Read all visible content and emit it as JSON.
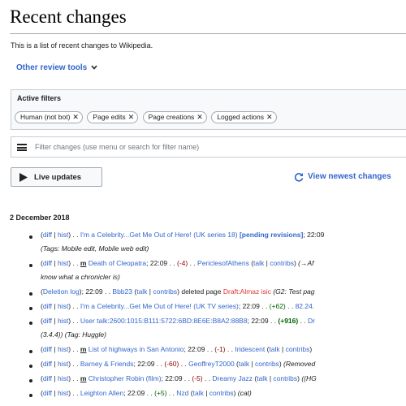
{
  "page": {
    "title": "Recent changes",
    "intro": "This is a list of recent changes to Wikipedia.",
    "review_tools": "Other review tools"
  },
  "filters": {
    "title": "Active filters",
    "chips": [
      "Human (not bot)",
      "Page edits",
      "Page creations",
      "Logged actions"
    ],
    "search_placeholder": "Filter changes (use menu or search for filter name)"
  },
  "controls": {
    "live_updates": "Live updates",
    "view_newest": "View newest changes"
  },
  "date_heading": "2 December 2018",
  "common": {
    "diff": "diff",
    "hist": "hist",
    "sep": " | ",
    "dots": " . . ",
    "m": "m",
    "talk": "talk",
    "contribs": "contribs",
    "time": "22:09",
    "open_paren": "(",
    "close_paren": ")",
    "semi": "; "
  },
  "changes": [
    {
      "page": "I'm a Celebrity...Get Me Out of Here! (UK series 18)",
      "flag": "[pending revisions]",
      "rest": "; 22:09",
      "tags": "(Tags: Mobile edit, Mobile web edit)"
    },
    {
      "minor": "m",
      "page": "Death of Cleopatra",
      "size": "(-4)",
      "user": "PericlesofAthens",
      "summary": "(→Af",
      "summary2": "know what a chronicler is)"
    },
    {
      "log": "Deletion log",
      "user": "Bbb23",
      "action": "deleted page",
      "target": "Draft:Almaz isic",
      "reason": "(G2: Test pag"
    },
    {
      "page": "I'm a Celebrity...Get Me Out of Here! (UK TV series)",
      "size": "(+62)",
      "user": "82.24."
    },
    {
      "page": "User talk:2600:1015:B111:5722:6BD:8E6E:B8A2:88B8",
      "size": "(+916)",
      "user": "Dr",
      "cont": "(3.4.4))",
      "tag": "(Tag: Huggle)"
    },
    {
      "minor": "m",
      "page": "List of highways in San Antonio",
      "size": "(-1)",
      "user": "Iridescent"
    },
    {
      "page": "Barney & Friends",
      "size": "(-60)",
      "user": "GeoffreyT2000",
      "summary": "(Removed"
    },
    {
      "minor": "m",
      "page": "Christopher Robin (film)",
      "size": "(-5)",
      "user": "Dreamy Jazz",
      "summary": "((HG"
    },
    {
      "page": "Leighton Allen",
      "size": "(+5)",
      "user": "Nzd",
      "summary": "(cat)"
    }
  ],
  "colors": {
    "link": "#3366cc",
    "red_link": "#dd3333",
    "positive": "#006400",
    "negative": "#8b0000"
  }
}
